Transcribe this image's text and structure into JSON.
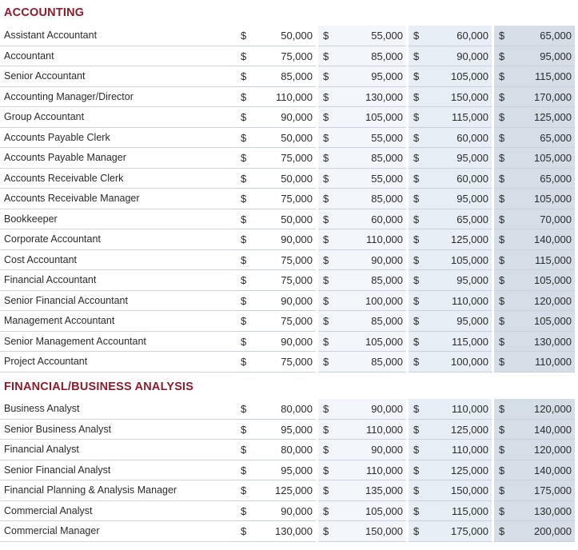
{
  "currency_symbol": "$",
  "sections": [
    {
      "title": "ACCOUNTING",
      "rows": [
        {
          "role": "Assistant Accountant",
          "values": [
            "50,000",
            "55,000",
            "60,000",
            "65,000"
          ]
        },
        {
          "role": "Accountant",
          "values": [
            "75,000",
            "85,000",
            "90,000",
            "95,000"
          ]
        },
        {
          "role": "Senior Accountant",
          "values": [
            "85,000",
            "95,000",
            "105,000",
            "115,000"
          ]
        },
        {
          "role": "Accounting Manager/Director",
          "values": [
            "110,000",
            "130,000",
            "150,000",
            "170,000"
          ]
        },
        {
          "role": "Group Accountant",
          "values": [
            "90,000",
            "105,000",
            "115,000",
            "125,000"
          ]
        },
        {
          "role": "Accounts Payable Clerk",
          "values": [
            "50,000",
            "55,000",
            "60,000",
            "65,000"
          ]
        },
        {
          "role": "Accounts Payable Manager",
          "values": [
            "75,000",
            "85,000",
            "95,000",
            "105,000"
          ]
        },
        {
          "role": "Accounts Receivable Clerk",
          "values": [
            "50,000",
            "55,000",
            "60,000",
            "65,000"
          ]
        },
        {
          "role": "Accounts Receivable Manager",
          "values": [
            "75,000",
            "85,000",
            "95,000",
            "105,000"
          ]
        },
        {
          "role": "Bookkeeper",
          "values": [
            "50,000",
            "60,000",
            "65,000",
            "70,000"
          ]
        },
        {
          "role": "Corporate Accountant",
          "values": [
            "90,000",
            "110,000",
            "125,000",
            "140,000"
          ]
        },
        {
          "role": "Cost Accountant",
          "values": [
            "75,000",
            "90,000",
            "105,000",
            "115,000"
          ]
        },
        {
          "role": "Financial Accountant",
          "values": [
            "75,000",
            "85,000",
            "95,000",
            "105,000"
          ]
        },
        {
          "role": "Senior Financial Accountant",
          "values": [
            "90,000",
            "100,000",
            "110,000",
            "120,000"
          ]
        },
        {
          "role": "Management Accountant",
          "values": [
            "75,000",
            "85,000",
            "95,000",
            "105,000"
          ]
        },
        {
          "role": "Senior Management Accountant",
          "values": [
            "90,000",
            "105,000",
            "115,000",
            "130,000"
          ]
        },
        {
          "role": "Project Accountant",
          "values": [
            "75,000",
            "85,000",
            "100,000",
            "110,000"
          ]
        }
      ]
    },
    {
      "title": "FINANCIAL/BUSINESS ANALYSIS",
      "rows": [
        {
          "role": "Business Analyst",
          "values": [
            "80,000",
            "90,000",
            "110,000",
            "120,000"
          ]
        },
        {
          "role": "Senior Business Analyst",
          "values": [
            "95,000",
            "110,000",
            "125,000",
            "140,000"
          ]
        },
        {
          "role": "Financial Analyst",
          "values": [
            "80,000",
            "90,000",
            "110,000",
            "120,000"
          ]
        },
        {
          "role": "Senior Financial Analyst",
          "values": [
            "95,000",
            "110,000",
            "125,000",
            "140,000"
          ]
        },
        {
          "role": "Financial Planning & Analysis Manager",
          "values": [
            "125,000",
            "135,000",
            "150,000",
            "175,000"
          ]
        },
        {
          "role": "Commercial Analyst",
          "values": [
            "90,000",
            "105,000",
            "115,000",
            "130,000"
          ]
        },
        {
          "role": "Commercial Manager",
          "values": [
            "130,000",
            "150,000",
            "175,000",
            "200,000"
          ]
        }
      ]
    }
  ]
}
